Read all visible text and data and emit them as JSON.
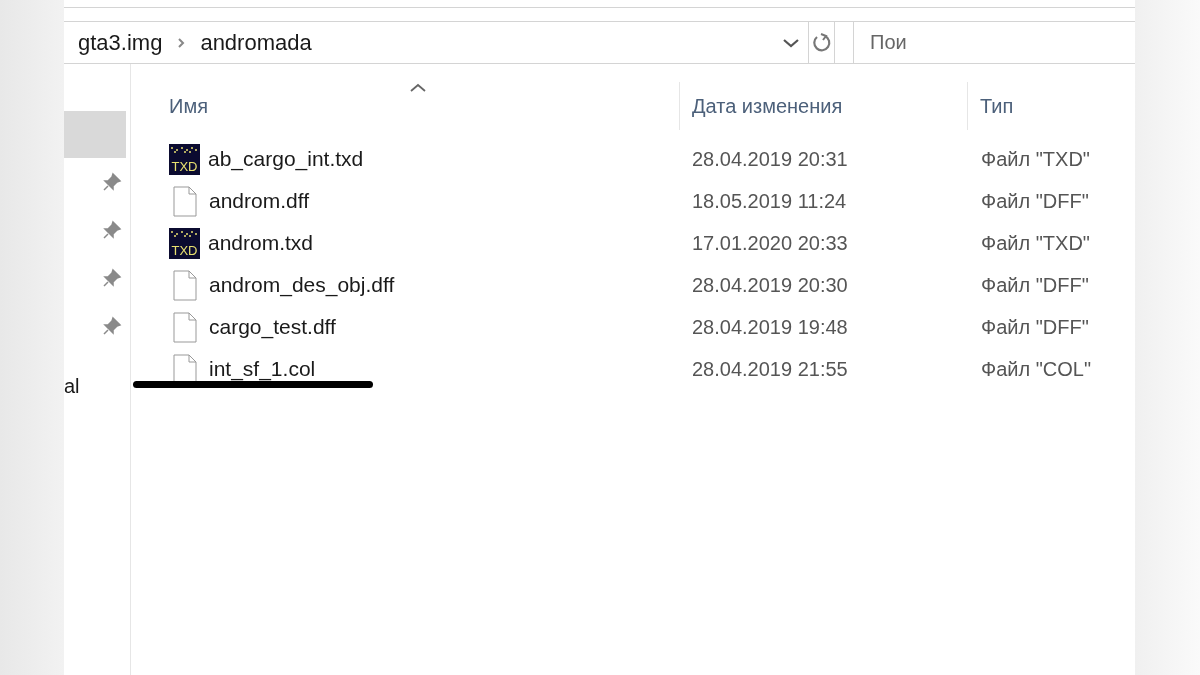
{
  "address_bar": {
    "path": [
      "gta3.img",
      "andromada"
    ]
  },
  "search": {
    "placeholder": "Пои"
  },
  "nav_pane": {
    "items": [
      {
        "kind": "selected"
      },
      {
        "kind": "pinned"
      },
      {
        "kind": "pinned"
      },
      {
        "kind": "pinned"
      },
      {
        "kind": "pinned"
      },
      {
        "kind": "label",
        "label": "al"
      }
    ]
  },
  "table": {
    "columns": [
      {
        "label": "Имя",
        "sorted": true
      },
      {
        "label": "Дата изменения",
        "sorted": false
      },
      {
        "label": "Тип",
        "sorted": false
      }
    ],
    "rows": [
      {
        "kind": "txd",
        "icon_label": "TXD",
        "name": "ab_cargo_int.txd",
        "date": "28.04.2019 20:31",
        "type": "Файл \"TXD\"",
        "underlined": false
      },
      {
        "kind": "blank",
        "name": "androm.dff",
        "date": "18.05.2019 11:24",
        "type": "Файл \"DFF\"",
        "underlined": false
      },
      {
        "kind": "txd",
        "icon_label": "TXD",
        "name": "androm.txd",
        "date": "17.01.2020 20:33",
        "type": "Файл \"TXD\"",
        "underlined": false
      },
      {
        "kind": "blank",
        "name": "androm_des_obj.dff",
        "date": "28.04.2019 20:30",
        "type": "Файл \"DFF\"",
        "underlined": false
      },
      {
        "kind": "blank",
        "name": "cargo_test.dff",
        "date": "28.04.2019 19:48",
        "type": "Файл \"DFF\"",
        "underlined": false
      },
      {
        "kind": "blank",
        "name": "int_sf_1.col",
        "date": "28.04.2019 21:55",
        "type": "Файл \"COL\"",
        "underlined": true
      }
    ]
  }
}
